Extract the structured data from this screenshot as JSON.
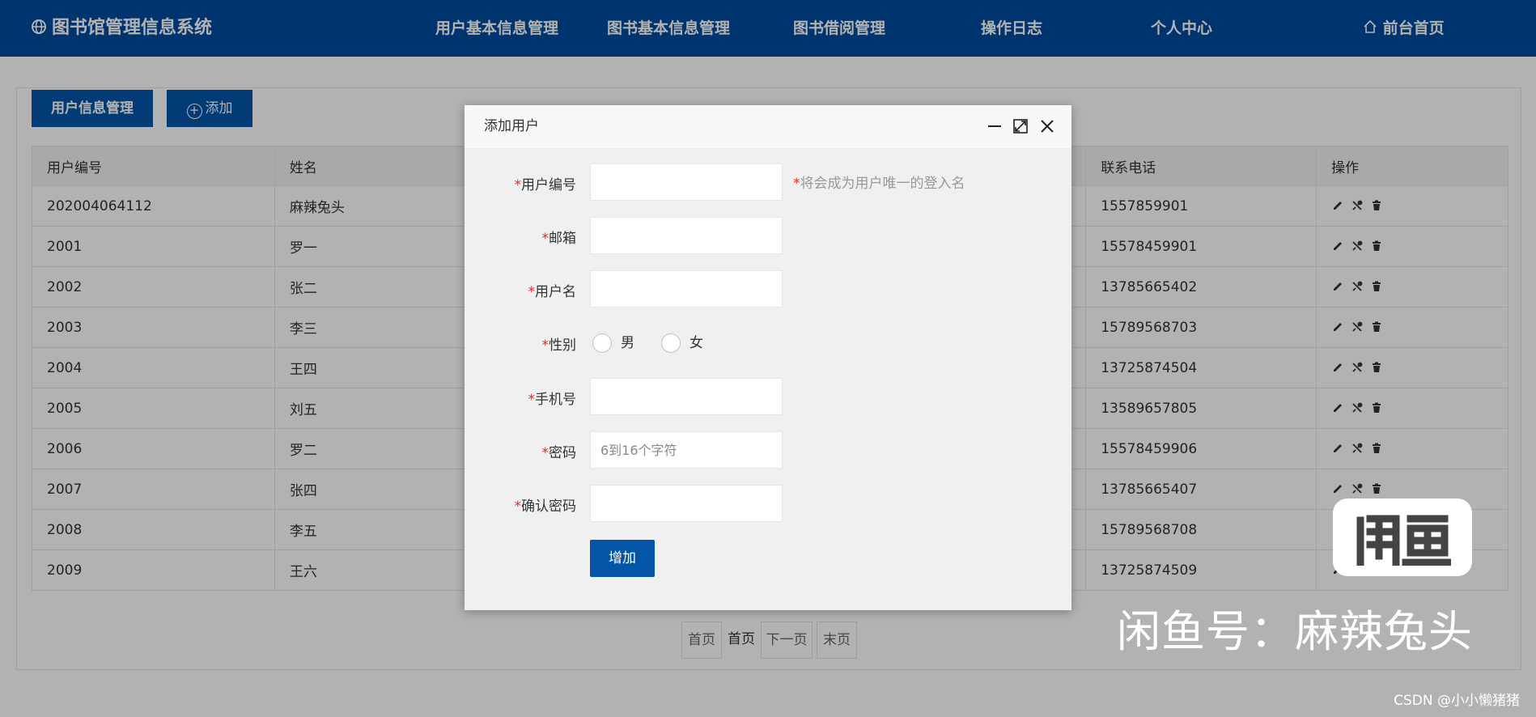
{
  "nav": {
    "brand": "图书馆管理信息系统",
    "items": [
      "用户基本信息管理",
      "图书基本信息管理",
      "图书借阅管理",
      "操作日志",
      "个人中心"
    ],
    "home": "前台首页"
  },
  "toolbar": {
    "tab_active": "用户信息管理",
    "add_label": "添加"
  },
  "table": {
    "columns": [
      "用户编号",
      "姓名",
      "联系电话",
      "操作"
    ],
    "rows": [
      {
        "id": "202004064112",
        "name": "麻辣兔头",
        "phone": "1557859901"
      },
      {
        "id": "2001",
        "name": "罗一",
        "phone": "15578459901"
      },
      {
        "id": "2002",
        "name": "张二",
        "phone": "13785665402"
      },
      {
        "id": "2003",
        "name": "李三",
        "phone": "15789568703"
      },
      {
        "id": "2004",
        "name": "王四",
        "phone": "13725874504"
      },
      {
        "id": "2005",
        "name": "刘五",
        "phone": "13589657805"
      },
      {
        "id": "2006",
        "name": "罗二",
        "phone": "15578459906"
      },
      {
        "id": "2007",
        "name": "张四",
        "phone": "13785665407"
      },
      {
        "id": "2008",
        "name": "李五",
        "phone": "15789568708"
      },
      {
        "id": "2009",
        "name": "王六",
        "phone": "13725874509"
      }
    ]
  },
  "pager": {
    "first": "首页",
    "current": "首页",
    "next": "下一页",
    "last": "末页"
  },
  "modal": {
    "title": "添加用户",
    "required_mark": "*",
    "fields": {
      "user_id": {
        "label": "用户编号",
        "hint": "将会成为用户唯一的登入名",
        "value": ""
      },
      "email": {
        "label": "邮箱",
        "value": ""
      },
      "username": {
        "label": "用户名",
        "value": ""
      },
      "gender": {
        "label": "性别",
        "options": [
          "男",
          "女"
        ]
      },
      "phone": {
        "label": "手机号",
        "value": ""
      },
      "password": {
        "label": "密码",
        "placeholder": "6到16个字符",
        "value": ""
      },
      "confirm": {
        "label": "确认密码",
        "value": ""
      }
    },
    "submit_label": "增加"
  },
  "watermark": {
    "logo_text": "闲鱼",
    "text": "闲鱼号：麻辣兔头",
    "csdn": "CSDN @小小懒猪猪"
  },
  "colors": {
    "nav_bg": "#004b9e",
    "primary": "#0355a8",
    "required": "#e02b2b"
  }
}
